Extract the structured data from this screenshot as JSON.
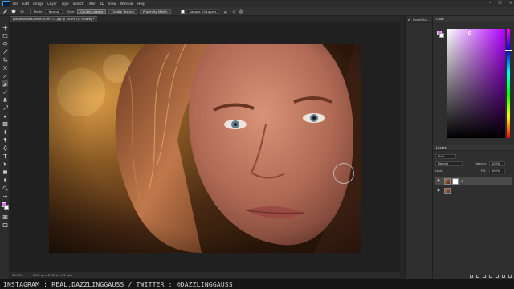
{
  "app": {
    "menus": [
      "File",
      "Edit",
      "Image",
      "Layer",
      "Type",
      "Select",
      "Filter",
      "3D",
      "View",
      "Window",
      "Help"
    ],
    "window_controls": [
      "–",
      "☐",
      "✕"
    ]
  },
  "options": {
    "brush_size": "39",
    "mode_label": "Mode:",
    "mode_value": "Normal",
    "type_label": "Type:",
    "type_buttons": [
      "Content-Aware",
      "Create Texture",
      "Proximity Match"
    ],
    "sample_label": "Sample All Layers",
    "angle_value": "0°"
  },
  "document": {
    "tab_title": "jeanie-brooks-bride-1029172.jpg @ 33.5% (1, RGB/8) *"
  },
  "status": {
    "zoom": "33.33%",
    "doc_size": "3240 px x 2160 px (72 ppi)"
  },
  "brush_panel": {
    "title": "Brush Se..."
  },
  "color_panel": {
    "title": "Color",
    "foreground": "#e56cff",
    "background": "#ffffff"
  },
  "layers_panel": {
    "title": "Layers",
    "kind_label": "Kind",
    "blend_mode": "Normal",
    "opacity_label": "Opacity:",
    "opacity_value": "100%",
    "lock_label": "Lock:",
    "fill_label": "Fill:",
    "fill_value": "100%",
    "layers": [
      {
        "name": "1",
        "visible": true,
        "selected": true
      },
      {
        "name": "",
        "visible": true,
        "selected": false
      }
    ]
  },
  "watermark": {
    "text": "INSTAGRAM : REAL.DAZZLINGGAUSS / TWITTER : @DAZZLINGGAUSS"
  }
}
